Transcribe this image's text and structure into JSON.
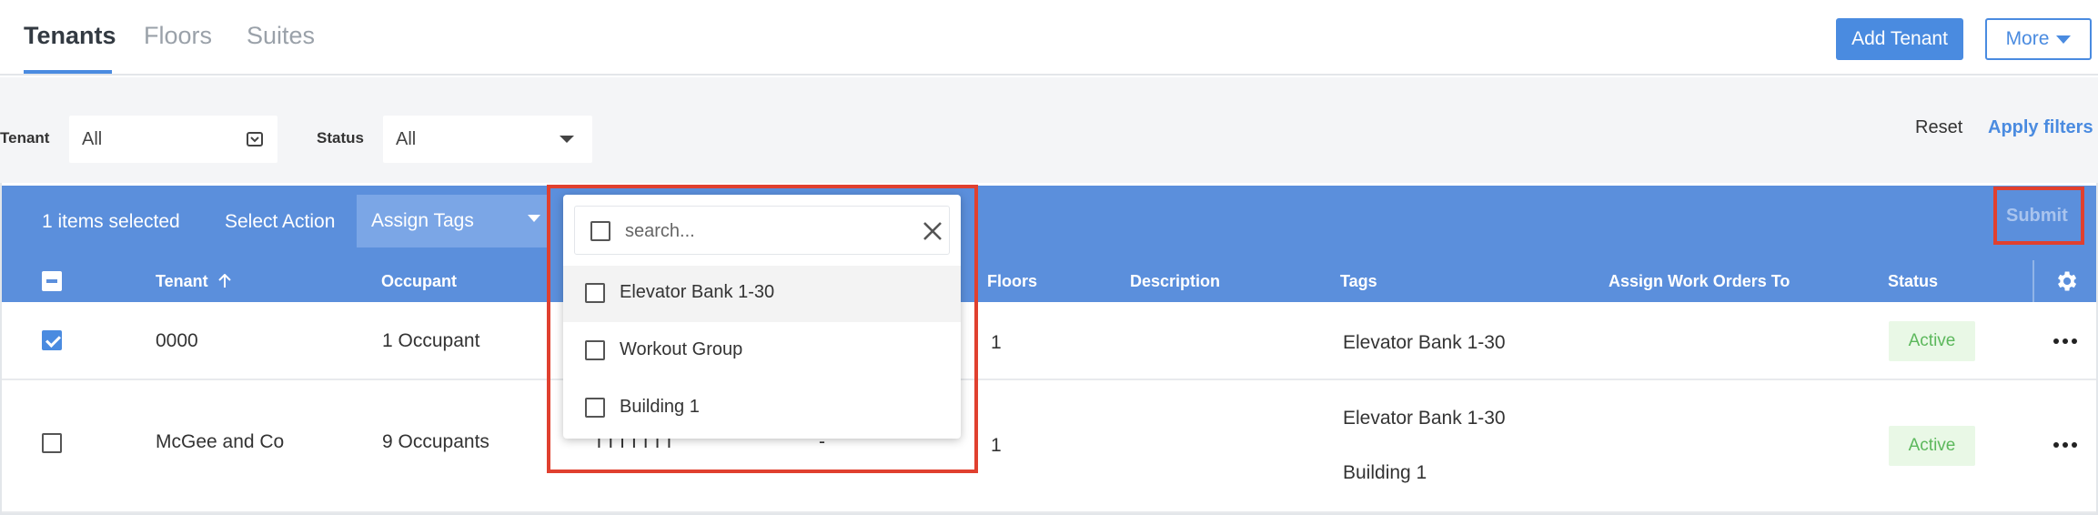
{
  "tabs": [
    {
      "label": "Tenants",
      "active": true
    },
    {
      "label": "Floors",
      "active": false
    },
    {
      "label": "Suites",
      "active": false
    }
  ],
  "header_actions": {
    "add_tenant": "Add Tenant",
    "more": "More"
  },
  "filters": {
    "tenant_label": "Tenant",
    "tenant_value": "All",
    "status_label": "Status",
    "status_value": "All",
    "reset": "Reset",
    "apply": "Apply filters"
  },
  "action_bar": {
    "selected_text": "1 items selected",
    "select_action": "Select Action",
    "assign_tags": "Assign Tags",
    "submit": "Submit"
  },
  "table": {
    "columns": [
      "Tenant",
      "Occupant",
      "Floors",
      "Description",
      "Tags",
      "Assign Work Orders To",
      "Status"
    ],
    "rows": [
      {
        "checked": true,
        "tenant": "0000",
        "occupant": "1 Occupant",
        "floors": "1",
        "tags": [
          "Elevator Bank 1-30"
        ],
        "status": "Active"
      },
      {
        "checked": false,
        "tenant": "McGee and Co",
        "occupant": "9 Occupants",
        "partial": "TTTTTTT",
        "dash": "-",
        "floors": "1",
        "tags": [
          "Elevator Bank 1-30",
          "Building 1"
        ],
        "status": "Active"
      }
    ]
  },
  "tag_dropdown": {
    "search_placeholder": "search...",
    "options": [
      "Elevator Bank 1-30",
      "Workout Group",
      "Building 1"
    ]
  },
  "colors": {
    "accent": "#4a8be0",
    "bar": "#5b8fdc",
    "highlight": "#e0402f",
    "active_badge_bg": "#e9f8e6",
    "active_badge_text": "#5cb85c"
  }
}
